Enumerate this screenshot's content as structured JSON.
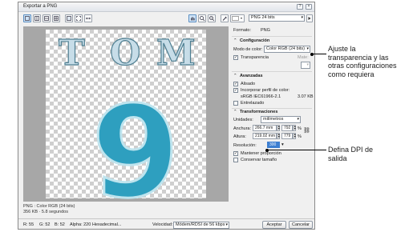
{
  "dialog": {
    "title": "Exportar a PNG",
    "format_preset": "PNG 24 bits",
    "format_label": "Formato:",
    "format_value": "PNG",
    "config": {
      "header": "Configuración",
      "color_mode_label": "Modo de color:",
      "color_mode_value": "Color RGB (24 bits)",
      "transparency_label": "Transparencia",
      "transparency_checked": true,
      "matte_label": "Mate:"
    },
    "advanced": {
      "header": "Avanzadas",
      "smooth_label": "Alisado",
      "smooth_checked": true,
      "embed_profile_label": "Incorporar perfil de color:",
      "embed_profile_checked": true,
      "profile_name": "sRGB IEC61966-2.1",
      "profile_size": "3.07 KB",
      "interlaced_label": "Entrelazado",
      "interlaced_checked": false
    },
    "transform": {
      "header": "Transformaciones",
      "units_label": "Unidades:",
      "units_value": "milímetros",
      "width_label": "Anchura:",
      "width_value": "266.7 mm",
      "width_pct": "792",
      "height_label": "Altura:",
      "height_value": "219.02 mm",
      "height_pct": "779",
      "pct_symbol": "%",
      "resolution_label": "Resolución:",
      "resolution_value": "300",
      "keep_ratio_label": "Mantener proporción",
      "keep_ratio_checked": true,
      "keep_size_label": "Conservar tamaño",
      "keep_size_checked": false
    },
    "preview": {
      "letters": [
        "T",
        "O",
        "M"
      ],
      "number": "9"
    },
    "status": {
      "line1": "PNG : Color RGB (24 bits)",
      "line2": "356 KB · 5.8 segundos"
    },
    "bottom": {
      "r": "R: 55",
      "g": "G: 52",
      "b": "B: 52",
      "alpha": "Alpha: 220",
      "hex": "Hexadecimal...",
      "speed_label": "Velocidad:",
      "speed_value": "Módem/RDSI de 56 kbps",
      "accept": "Aceptar",
      "cancel": "Cancelar"
    }
  },
  "callouts": {
    "top": [
      "Ajuste la",
      "transparencia y las",
      "otras configuraciones",
      "como requiera"
    ],
    "bottom": [
      "Defina DPI de",
      "salida"
    ]
  },
  "colors": {
    "canvas_bg": "#a7a7a7",
    "accent": "#5c8fc2",
    "nine_fill": "#2e9fbf"
  }
}
